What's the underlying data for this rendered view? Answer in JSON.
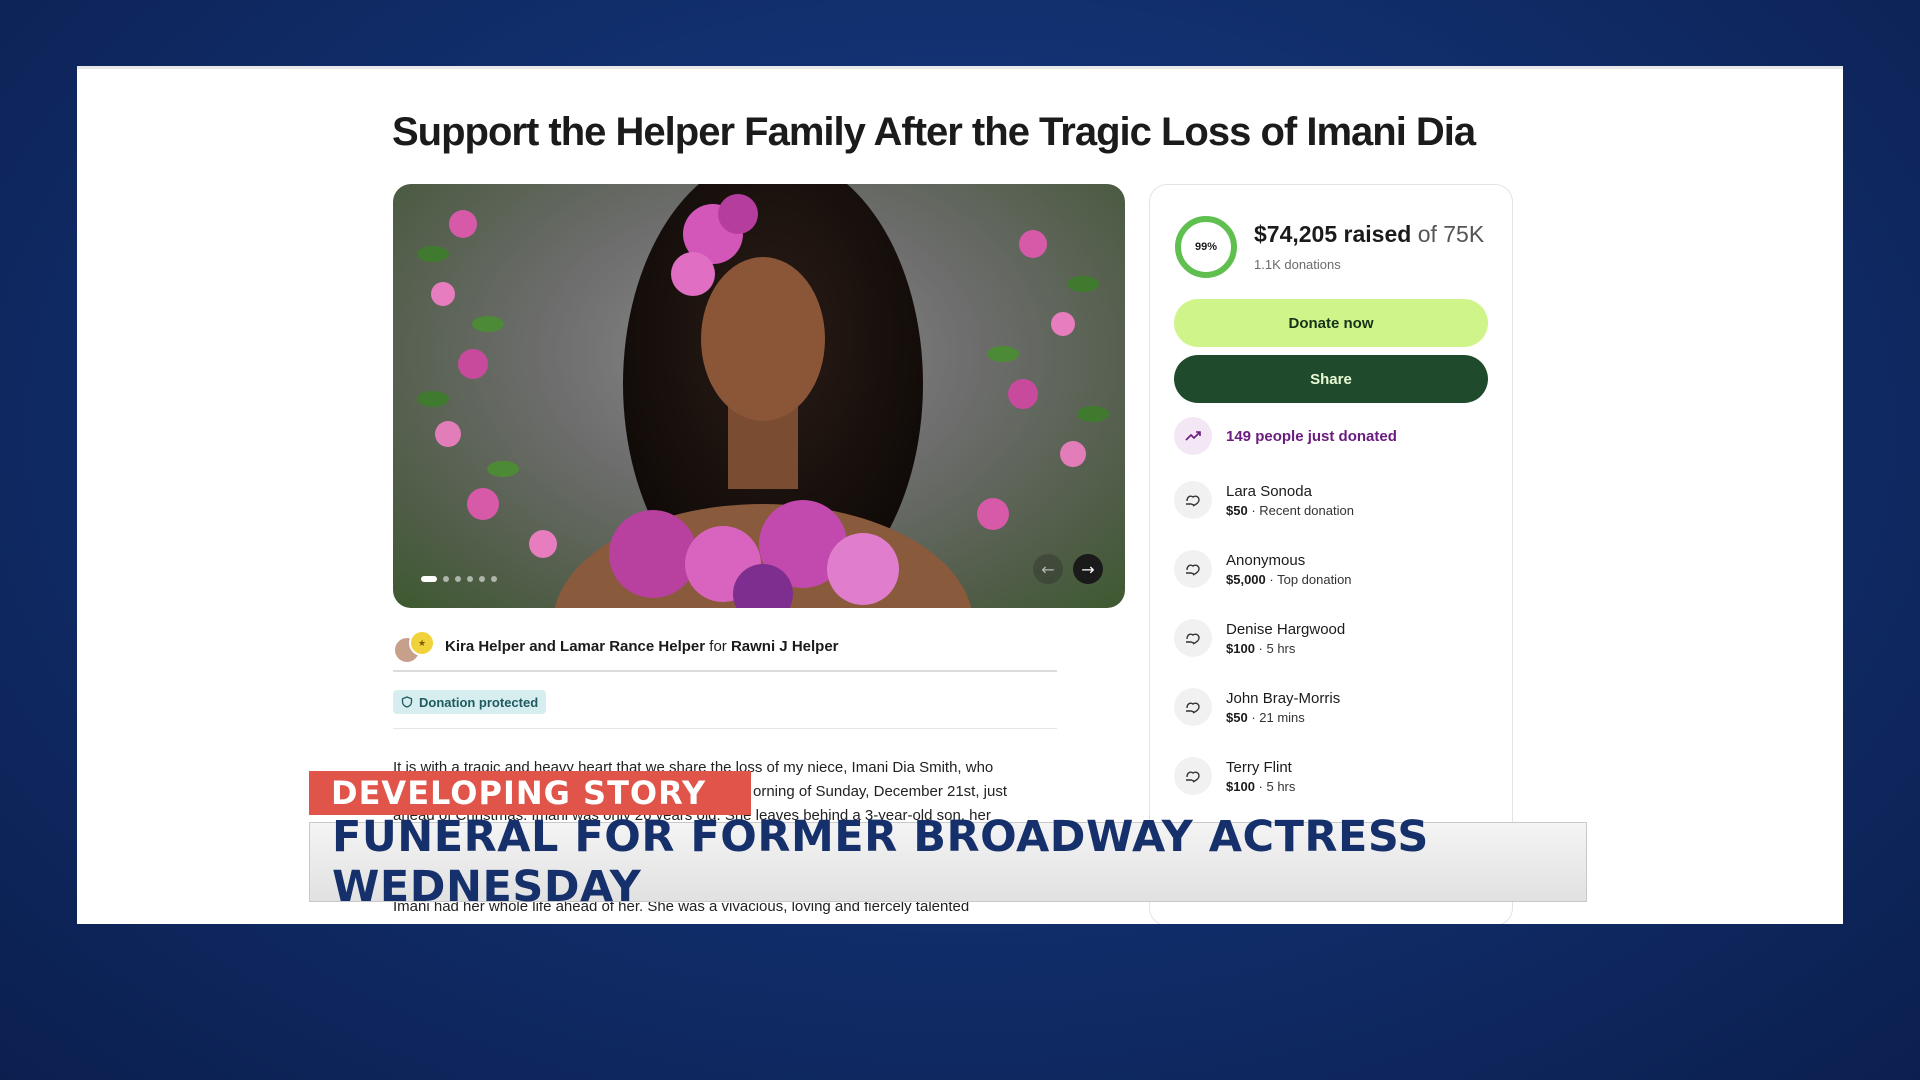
{
  "campaign": {
    "title": "Support the Helper Family After the Tragic Loss of Imani Dia",
    "carousel": {
      "slide_count": 6,
      "active_index": 0
    }
  },
  "organizer": {
    "organizers": "Kira Helper and Lamar Rance Helper",
    "for_word": "for",
    "beneficiary": "Rawni J Helper"
  },
  "badge": {
    "label": "Donation protected"
  },
  "story": {
    "line1": "It is with a tragic and heavy heart that we share the loss of my niece, Imani Dia Smith, who",
    "line2": "orning of Sunday, December 21st, just",
    "line3": "ahead of Christmas. Imani was only 26 years old. She leaves behind a 3-year-old son, her",
    "line_lower": "Imani had her whole life ahead of her. She was a vivacious, loving and fiercely talented"
  },
  "fundraiser": {
    "progress_percent": 99,
    "progress_label": "99%",
    "raised_amount": "$74,205 raised",
    "goal_text": "of 75K",
    "donations_count": "1.1K donations",
    "donate_button": "Donate now",
    "share_button": "Share",
    "recent_activity": "149 people just donated",
    "accent_color": "#cff58a",
    "share_color": "#1f4a2c",
    "progress_color": "#5fc04f"
  },
  "donors": [
    {
      "name": "Lara Sonoda",
      "amount": "$50",
      "detail": " · Recent donation"
    },
    {
      "name": "Anonymous",
      "amount": "$5,000",
      "detail": " · Top donation"
    },
    {
      "name": "Denise Hargwood",
      "amount": "$100",
      "detail": " · 5 hrs"
    },
    {
      "name": "John Bray-Morris",
      "amount": "$50",
      "detail": " · 21 mins"
    },
    {
      "name": "Terry Flint",
      "amount": "$100",
      "detail": " · 5 hrs"
    }
  ],
  "broadcast": {
    "tag": "DEVELOPING STORY",
    "headline": "FUNERAL FOR FORMER BROADWAY ACTRESS WEDNESDAY",
    "tag_color": "#e0544a",
    "headline_color": "#15306b"
  }
}
